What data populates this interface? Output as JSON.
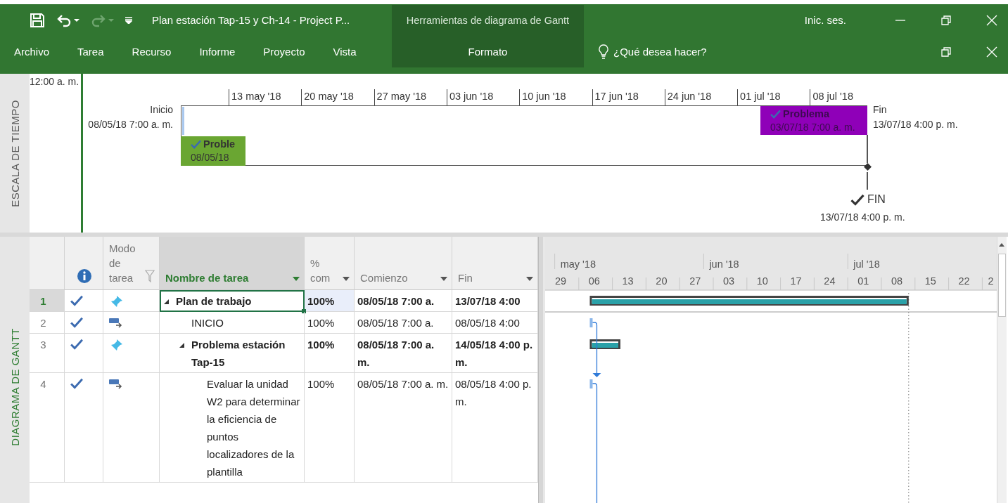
{
  "title_bar": {
    "quick_access": [
      {
        "kind": "save",
        "disabled": false
      },
      {
        "kind": "undo",
        "disabled": false
      },
      {
        "kind": "redo",
        "disabled": true
      },
      {
        "kind": "customize",
        "disabled": false
      }
    ],
    "title": "Plan estación Tap-15 y Ch-14  -  Project P...",
    "contextual_group": "Herramientas de diagrama de Gantt",
    "sign_in": "Inic. ses."
  },
  "ribbon": {
    "tabs": [
      {
        "label": "Archivo",
        "contextual": false
      },
      {
        "label": "Tarea",
        "contextual": false
      },
      {
        "label": "Recurso",
        "contextual": false
      },
      {
        "label": "Informe",
        "contextual": false
      },
      {
        "label": "Proyecto",
        "contextual": false
      },
      {
        "label": "Vista",
        "contextual": false
      },
      {
        "label": "Formato",
        "contextual": true
      }
    ],
    "tell_me": {
      "placeholder": "¿Qué desea hacer?"
    }
  },
  "timeline": {
    "side_label": "ESCALA DE TIEMPO",
    "current_time": "12:00 a. m.",
    "ticks": [
      "13 may '18",
      "20 may '18",
      "27 may '18",
      "03 jun '18",
      "10 jun '18",
      "17 jun '18",
      "24 jun '18",
      "01 jul '18",
      "08 jul '18"
    ],
    "start": {
      "label": "Inicio",
      "date": "08/05/18 7:00 a. m."
    },
    "finish": {
      "label": "Fin",
      "date": "13/07/18 4:00 p. m."
    },
    "bars": [
      {
        "title": "Proble",
        "date": "08/05/18",
        "color": "#6aa632",
        "done": true
      },
      {
        "title": "Problema",
        "date": "03/07/18 7:00 a. m.",
        "color": "#8f00b8",
        "done": true
      }
    ],
    "milestones": [
      {
        "title": "FIN",
        "date": "13/07/18 4:00 p. m.",
        "done": true
      }
    ]
  },
  "gantt": {
    "side_label": "DIAGRAMA DE GANTT",
    "columns": [
      {
        "kind": "info"
      },
      {
        "kind": "label",
        "label": "Modo de tarea",
        "filter": true,
        "dropdown": false,
        "highlighted": false
      },
      {
        "kind": "label",
        "label": "Nombre de tarea",
        "filter": false,
        "dropdown": true,
        "highlighted": true
      },
      {
        "kind": "label",
        "label": "% com",
        "filter": false,
        "dropdown": true,
        "highlighted": false
      },
      {
        "kind": "label",
        "label": "Comienzo",
        "filter": false,
        "dropdown": true,
        "highlighted": false
      },
      {
        "kind": "label",
        "label": "Fin",
        "filter": false,
        "dropdown": true,
        "highlighted": false
      }
    ],
    "rows": [
      {
        "id": "1",
        "done": true,
        "kind": "manual",
        "name": "Plan de trabajo",
        "summary": true,
        "expanded": true,
        "complete": "100%",
        "start": "08/05/18 7:00 a.",
        "finish": "13/07/18 4:00",
        "selected": true,
        "children": [
          {
            "id": "2",
            "done": true,
            "kind": "auto",
            "name": "INICIO",
            "summary": false,
            "complete": "100%",
            "start": "08/05/18 7:00 a.",
            "finish": "08/05/18 4:00",
            "selected": false
          },
          {
            "id": "3",
            "done": true,
            "kind": "manual",
            "name": "Problema estación Tap-15",
            "summary": true,
            "expanded": true,
            "complete": "100%",
            "start": "08/05/18 7:00 a. m.",
            "finish": "14/05/18 4:00 p. m.",
            "selected": false,
            "children": [
              {
                "id": "4",
                "done": true,
                "kind": "auto",
                "name": "Evaluar la unidad W2 para determinar la eficiencia de puntos localizadores de la plantilla",
                "summary": false,
                "complete": "100%",
                "start": "08/05/18 7:00 a. m.",
                "finish": "08/05/18 4:00 p. m.",
                "selected": false
              }
            ]
          }
        ]
      }
    ],
    "timescale": {
      "months": [
        "may '18",
        "jun '18",
        "jul '18"
      ],
      "weeks": [
        "29",
        "06",
        "13",
        "20",
        "27",
        "03",
        "10",
        "17",
        "24",
        "01",
        "08",
        "15",
        "22",
        "2"
      ]
    }
  }
}
